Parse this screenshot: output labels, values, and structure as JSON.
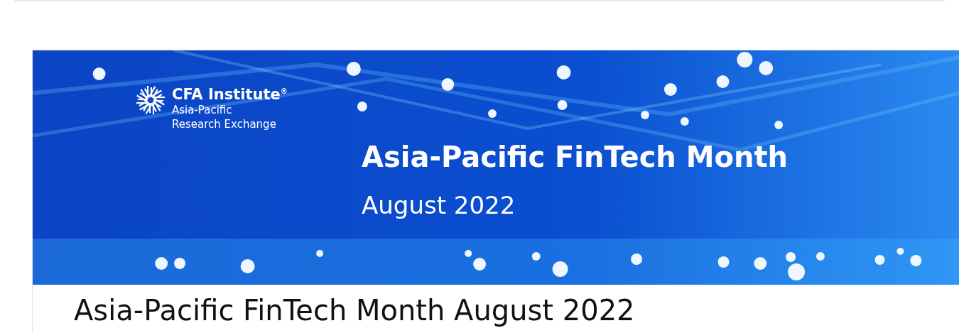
{
  "banner": {
    "logo": {
      "name": "CFA Institute",
      "mark": "®",
      "lines": [
        "Asia-Pacific",
        "Research Exchange"
      ]
    },
    "title": "Asia-Pacific FinTech Month",
    "subtitle": "August 2022"
  },
  "heading": "Asia-Pacific FinTech Month August 2022"
}
